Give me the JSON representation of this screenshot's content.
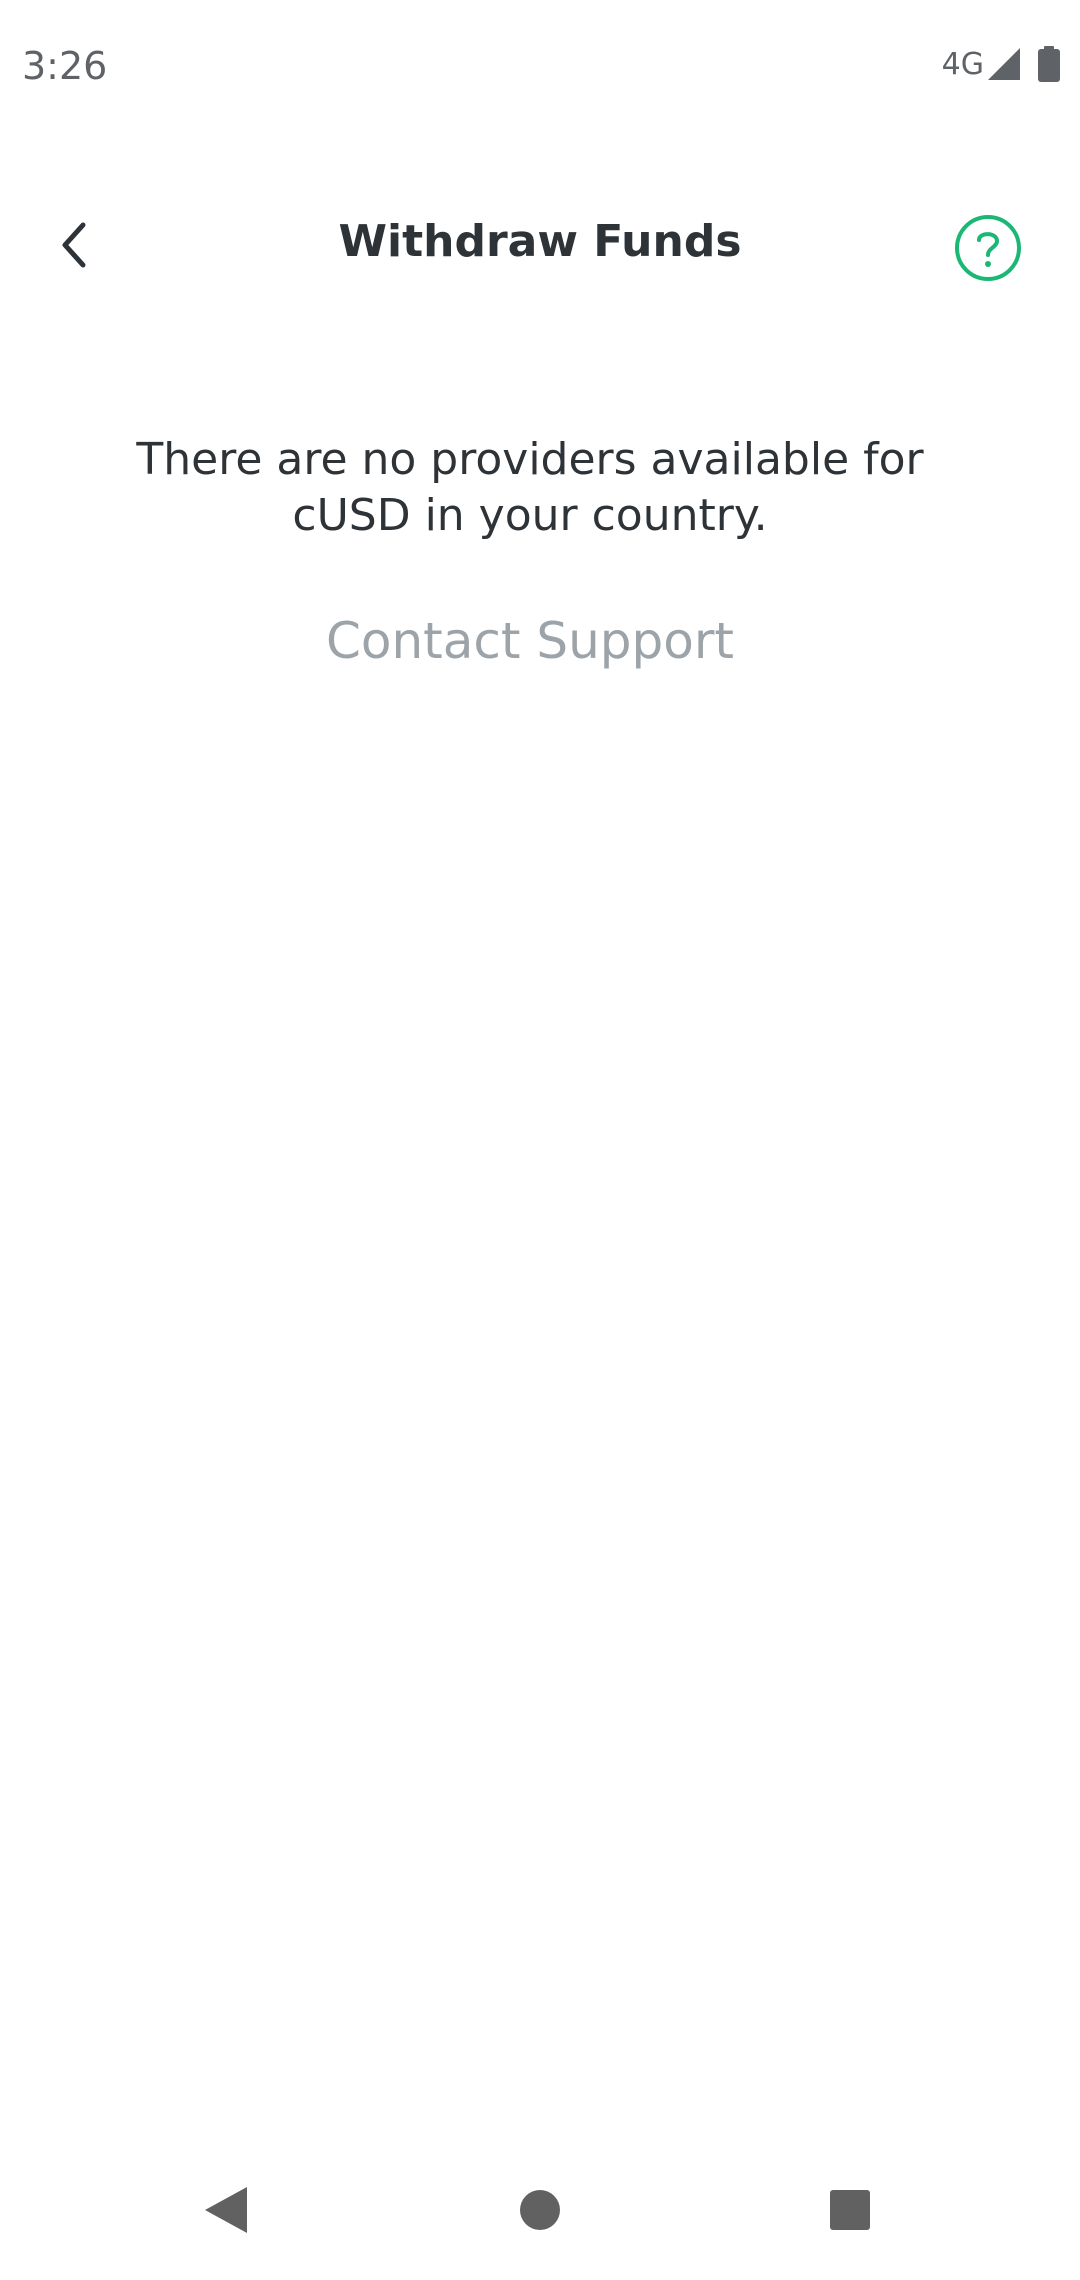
{
  "status_bar": {
    "time": "3:26",
    "network": "4G",
    "icons": [
      "signal-icon",
      "battery-icon"
    ]
  },
  "header": {
    "title": "Withdraw Funds",
    "back_icon": "chevron-left-icon",
    "help_icon": "help-circle-icon"
  },
  "main": {
    "message": "There are no providers available for cUSD in your country.",
    "contact_support_label": "Contact Support"
  },
  "nav_bar": {
    "icons": [
      "nav-back-icon",
      "nav-home-icon",
      "nav-recents-icon"
    ]
  },
  "colors": {
    "accent": "#1ab775",
    "text_primary": "#2e3338",
    "text_muted": "#9ca4a9",
    "system_gray": "#5f6368"
  }
}
